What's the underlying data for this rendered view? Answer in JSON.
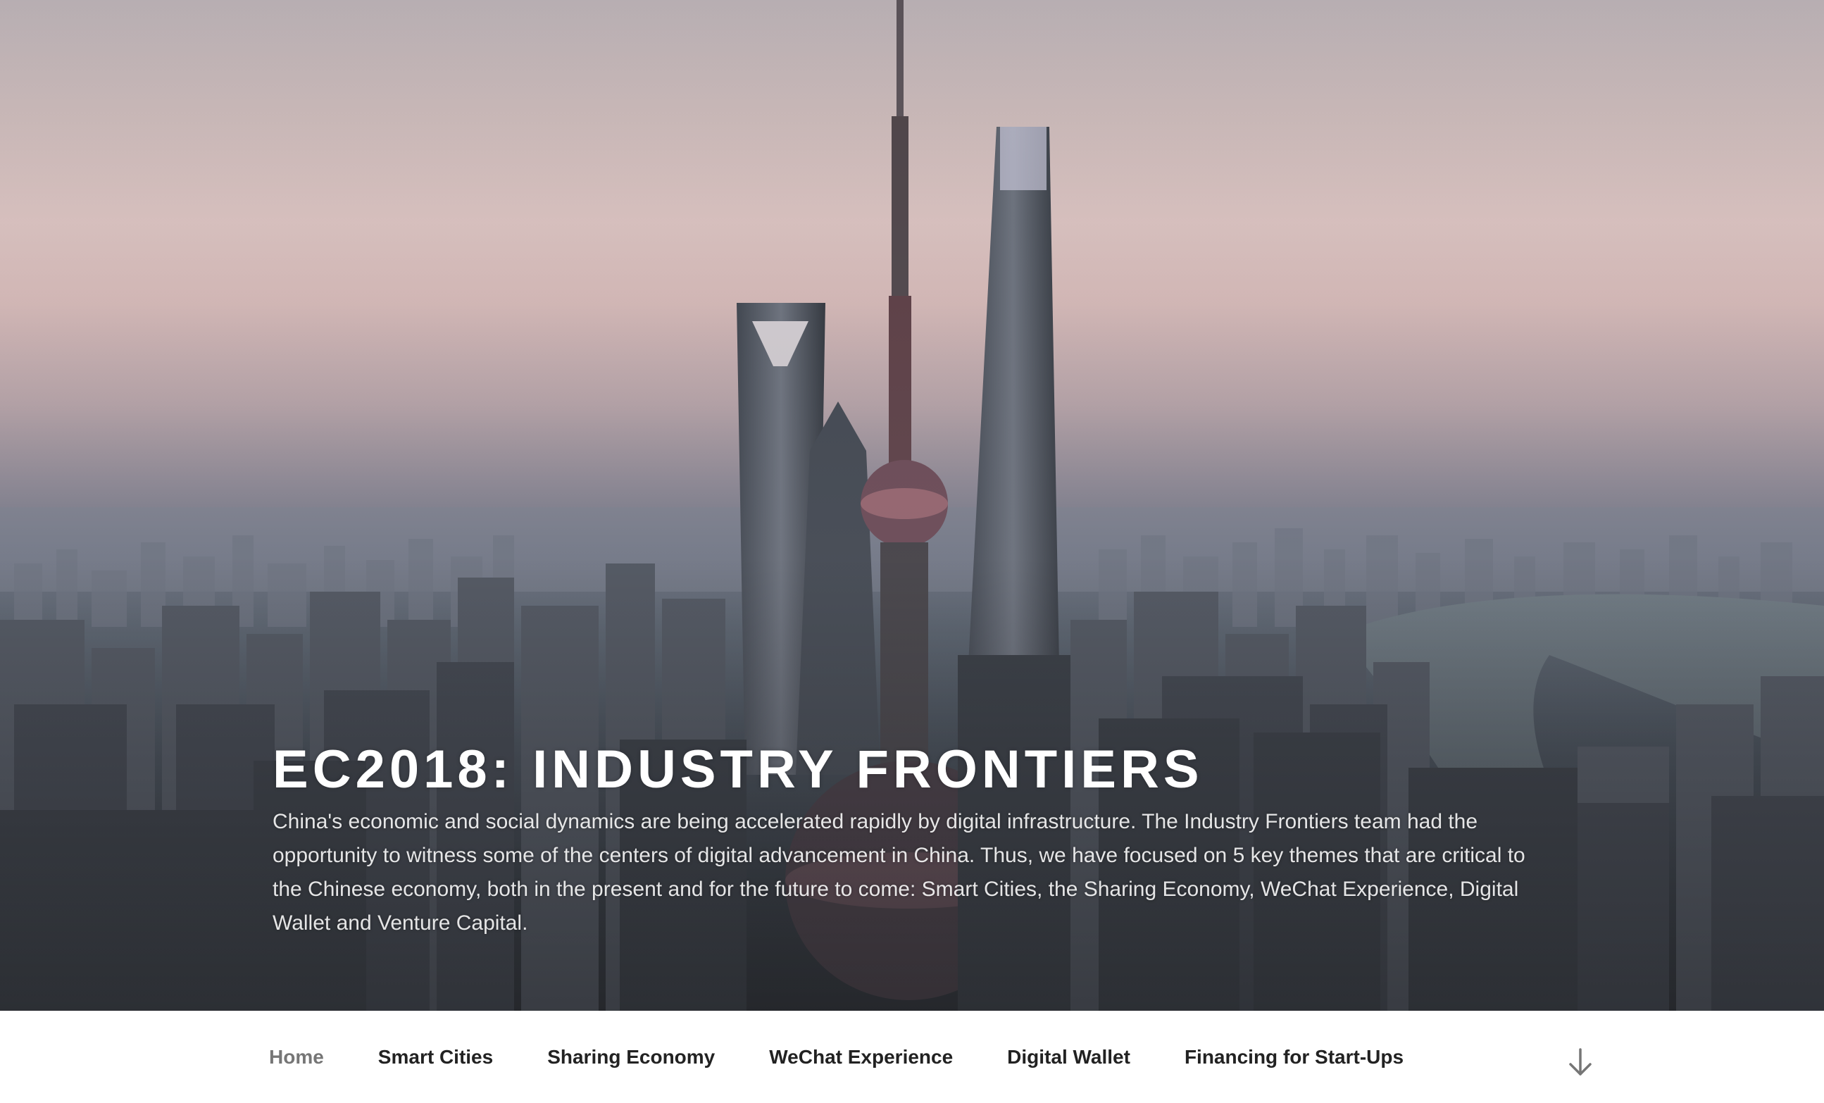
{
  "site": {
    "title": "EC2018: INDUSTRY FRONTIERS",
    "description": "China's economic and social dynamics are being accelerated rapidly by digital infrastructure. The Industry Frontiers team had the opportunity to witness some of the centers of digital advancement in China. Thus, we have focused on 5 key themes that are critical to the Chinese economy, both in the present and for the future to come: Smart Cities, the Sharing Economy, WeChat Experience, Digital Wallet and Venture Capital."
  },
  "header_image": {
    "description": "aerial photo of the Shanghai skyline at dusk"
  },
  "navigation": {
    "items": [
      {
        "label": "Home",
        "current": true
      },
      {
        "label": "Smart Cities"
      },
      {
        "label": "Sharing Economy"
      },
      {
        "label": "WeChat Experience"
      },
      {
        "label": "Digital Wallet"
      },
      {
        "label": "Financing for Start-Ups"
      }
    ],
    "scroll_icon": "arrow-down-icon"
  },
  "colors": {
    "nav_text": "#222222",
    "nav_current": "#767676",
    "title": "#ffffff"
  }
}
